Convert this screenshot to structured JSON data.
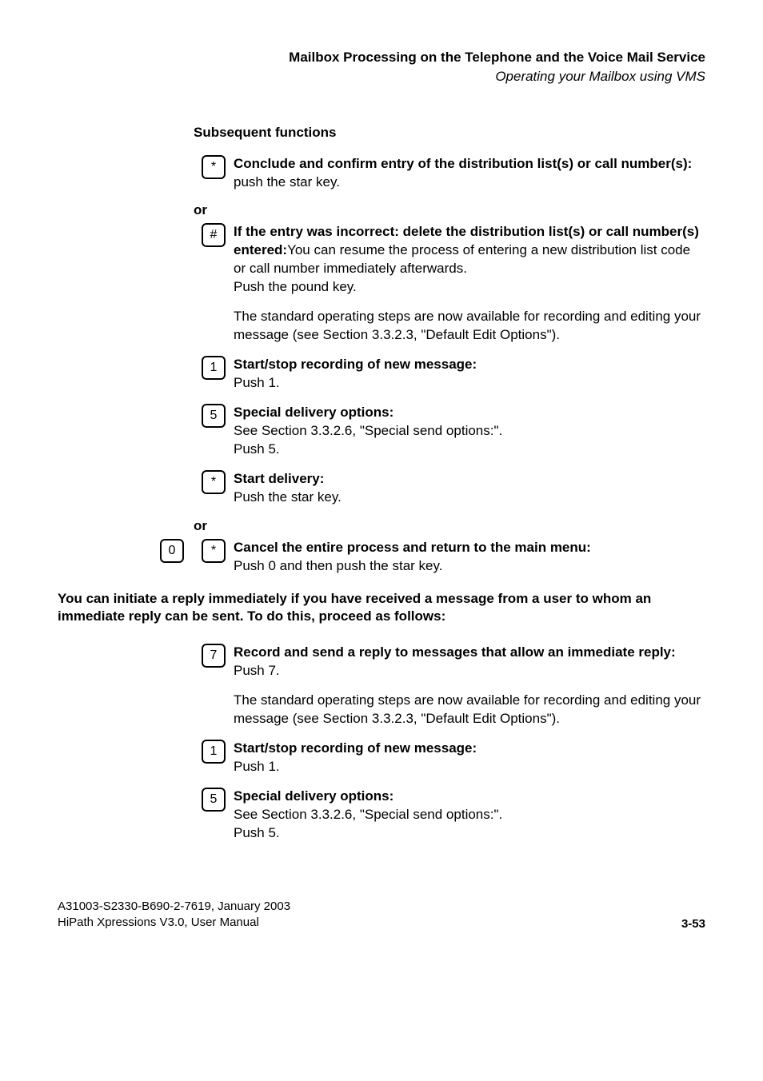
{
  "header": {
    "title": "Mailbox Processing on the Telephone and the Voice Mail Service",
    "subtitle": "Operating your Mailbox using VMS"
  },
  "sections": {
    "subsequent_heading": "Subsequent functions",
    "conclude": {
      "key": "*",
      "bold": "Conclude and confirm entry of the distribution list(s) or call number(s):",
      "rest": "push the star key."
    },
    "or1": "or",
    "incorrect": {
      "key": "#",
      "bold": "If the entry was incorrect: delete the distribution list(s) or call number(s) entered:",
      "rest1": "You can resume the process of entering a new distribution list code or call number immediately afterwards.",
      "rest2": "Push the pound key."
    },
    "standard1": "The standard operating steps are now available for recording and editing your message (see Section 3.3.2.3, \"Default Edit Options\").",
    "startstop1": {
      "key": "1",
      "bold": "Start/stop recording of new message:",
      "rest": "Push 1."
    },
    "special1": {
      "key": "5",
      "bold": "Special delivery options:",
      "rest1": "See Section 3.3.2.6, \"Special send options:\".",
      "rest2": "Push 5."
    },
    "startdelivery": {
      "key": "*",
      "bold": "Start delivery:",
      "rest": "Push the star key."
    },
    "or2": "or",
    "cancel": {
      "key1": "0",
      "key2": "*",
      "bold": "Cancel the entire process and return to the main menu:",
      "rest": "Push 0 and then push the star key."
    },
    "reply_intro": "You can initiate a reply immediately if you have received a message from a user to whom an immediate reply can be sent. To do this, proceed as follows:",
    "record7": {
      "key": "7",
      "bold": "Record and send a reply to messages that allow an immediate reply:",
      "rest": "Push 7."
    },
    "standard2": "The standard operating steps are now available for recording and editing your message (see Section 3.3.2.3, \"Default Edit Options\").",
    "startstop2": {
      "key": "1",
      "bold": "Start/stop recording of new message:",
      "rest": "Push 1."
    },
    "special2": {
      "key": "5",
      "bold": "Special delivery options:",
      "rest1": "See Section 3.3.2.6, \"Special send options:\".",
      "rest2": "Push 5."
    }
  },
  "footer": {
    "line1": "A31003-S2330-B690-2-7619, January 2003",
    "line2": "HiPath Xpressions V3.0, User Manual",
    "page": "3-53"
  }
}
